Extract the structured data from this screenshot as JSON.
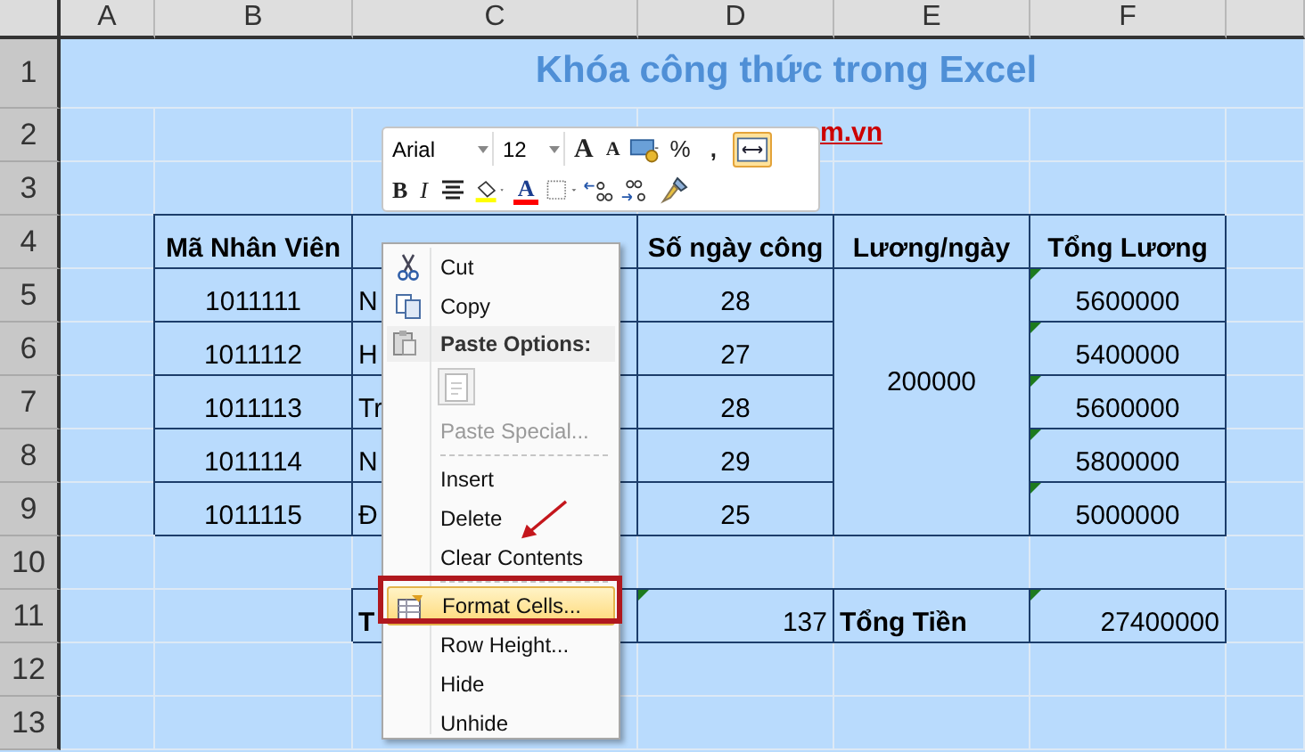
{
  "columns": [
    "A",
    "B",
    "C",
    "D",
    "E",
    "F",
    ""
  ],
  "rows": [
    "1",
    "2",
    "3",
    "4",
    "5",
    "6",
    "7",
    "8",
    "9",
    "10",
    "11",
    "12",
    "13"
  ],
  "title": "Khóa công thức trong Excel",
  "link_fragment": "m.vn",
  "headers": {
    "id": "Mã Nhân Viên",
    "days": "Số ngày công",
    "rate": "Lương/ngày",
    "total": "Tổng Lương"
  },
  "employees": [
    {
      "id": "1011111",
      "name": "N",
      "days": "28",
      "total": "5600000",
      "total_flag": true
    },
    {
      "id": "1011112",
      "name": "H",
      "days": "27",
      "total": "5400000",
      "total_flag": true
    },
    {
      "id": "1011113",
      "name": "Tr",
      "days": "28",
      "total": "5600000",
      "total_flag": true
    },
    {
      "id": "1011114",
      "name": "N",
      "days": "29",
      "total": "5800000",
      "total_flag": true
    },
    {
      "id": "1011115",
      "name": "Đ",
      "days": "25",
      "total": "5000000",
      "total_flag": true
    }
  ],
  "rate": "200000",
  "totals": {
    "name": "T",
    "days": "137",
    "days_flag": true,
    "label": "Tổng Tiền",
    "amount": "27400000",
    "amount_flag": true
  },
  "mini_toolbar": {
    "font": "Arial",
    "size": "12",
    "grow": "A",
    "shrink": "A",
    "percent": "%",
    "comma": ",",
    "wrap_active": true,
    "bold": "B",
    "italic": "I",
    "font_color": "A"
  },
  "context_menu": [
    {
      "kind": "cut",
      "label": "Cut",
      "disabled": false,
      "highlighted": false
    },
    {
      "kind": "copy",
      "label": "Copy",
      "disabled": false,
      "highlighted": false
    },
    {
      "kind": "header",
      "label": "Paste Options:"
    },
    {
      "kind": "pastebutton"
    },
    {
      "kind": "plain",
      "label": "Paste Special...",
      "disabled": true,
      "highlighted": false
    },
    {
      "kind": "separator"
    },
    {
      "kind": "plain",
      "label": "Insert",
      "disabled": false,
      "highlighted": false
    },
    {
      "kind": "plain",
      "label": "Delete",
      "disabled": false,
      "highlighted": false
    },
    {
      "kind": "plain",
      "label": "Clear Contents",
      "disabled": false,
      "highlighted": false
    },
    {
      "kind": "separator"
    },
    {
      "kind": "format",
      "label": "Format Cells...",
      "disabled": false,
      "highlighted": true
    },
    {
      "kind": "plain",
      "label": "Row Height...",
      "disabled": false,
      "highlighted": false
    },
    {
      "kind": "plain",
      "label": "Hide",
      "disabled": false,
      "highlighted": false
    },
    {
      "kind": "plain",
      "label": "Unhide",
      "disabled": false,
      "highlighted": false
    }
  ]
}
